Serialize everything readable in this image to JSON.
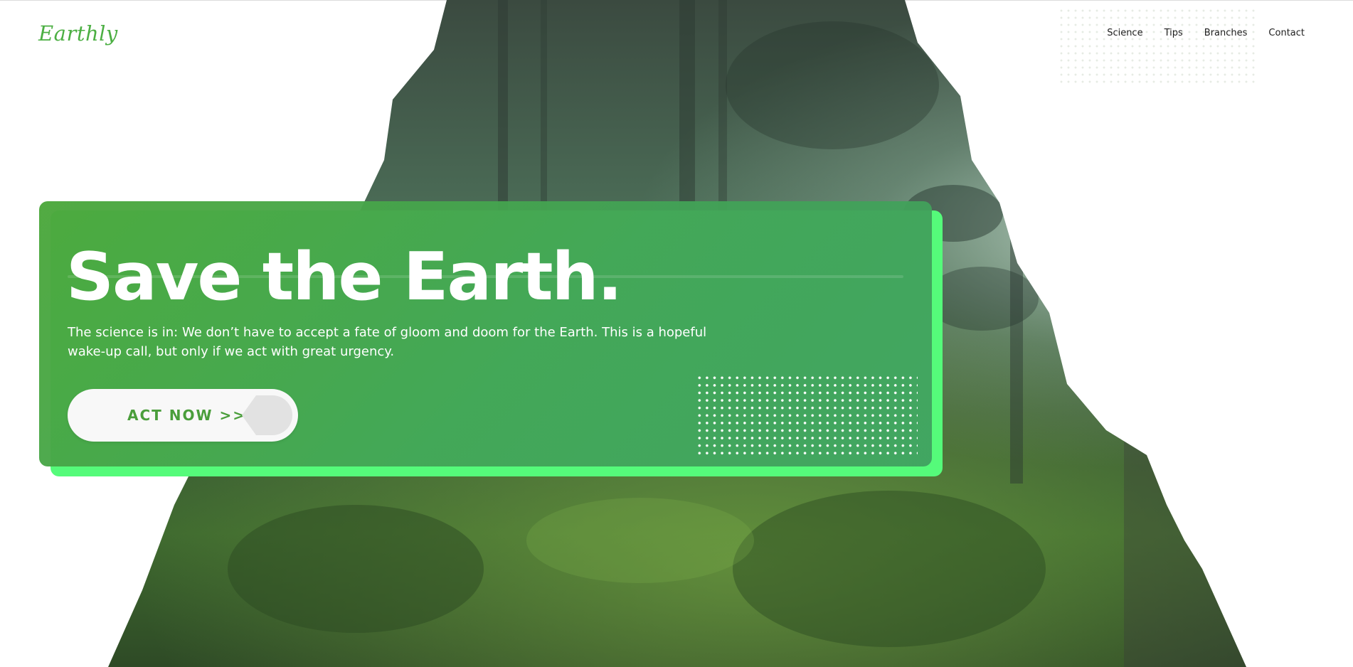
{
  "header": {
    "logo_text": "Earthly",
    "nav": [
      {
        "label": "Science"
      },
      {
        "label": "Tips"
      },
      {
        "label": "Branches"
      },
      {
        "label": "Contact"
      }
    ]
  },
  "hero": {
    "headline": "Save the Earth.",
    "subtext": "The science is in: We don’t have to accept a fate of gloom and doom for the Earth. This is a hopeful wake-up call, but only if we act with great urgency.",
    "cta_label": "ACT NOW >>>"
  },
  "colors": {
    "brand_green": "#4caf43",
    "card_green": "#45a552",
    "card_shadow_green": "#55fb7a",
    "button_bg": "#f8f8f8",
    "nav_text": "#1e1e1e"
  },
  "icons": {
    "cta_icon": "arrow-tab-icon"
  }
}
